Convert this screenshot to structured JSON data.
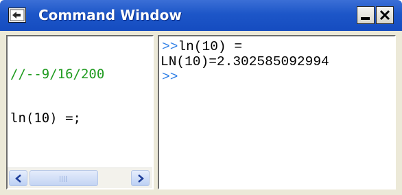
{
  "window": {
    "title": "Command Window",
    "title_icon": "undock-pin-icon",
    "minimize_icon": "minimize-icon",
    "close_icon": "close-icon"
  },
  "history": {
    "lines": [
      "//--9/16/200",
      "ln(10) =;"
    ],
    "scrollbar": {
      "left_icon": "chevron-left-icon",
      "right_icon": "chevron-right-icon"
    }
  },
  "console": {
    "prompt": ">>",
    "line1_command": "ln(10) =",
    "line2_output": "LN(10)=2.302585092994",
    "line3_prompt": ">>"
  },
  "colors": {
    "titlebar": "#1d56c8",
    "prompt": "#2f7fe6",
    "comment": "#1f9b1f",
    "frame": "#ece9d8"
  }
}
